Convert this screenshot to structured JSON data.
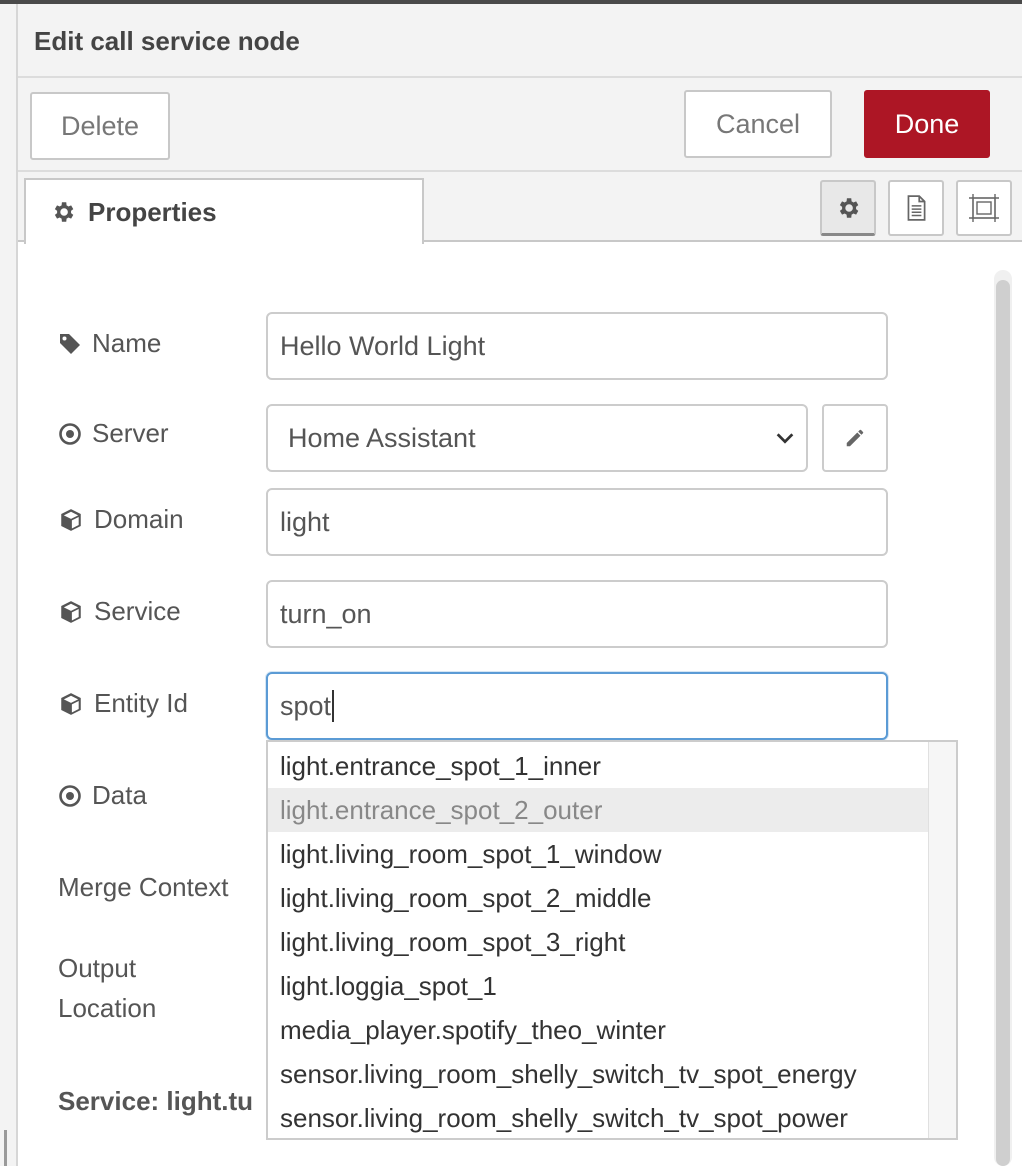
{
  "dialog": {
    "title": "Edit call service node"
  },
  "toolbar": {
    "delete_label": "Delete",
    "cancel_label": "Cancel",
    "done_label": "Done",
    "done_color": "#ad1625"
  },
  "tabs": {
    "properties_label": "Properties",
    "icons": [
      "gear-icon",
      "description-icon",
      "appearance-icon"
    ]
  },
  "form": {
    "name": {
      "label": "Name",
      "value": "Hello World Light",
      "icon": "tag-icon"
    },
    "server": {
      "label": "Server",
      "value": "Home Assistant",
      "icon": "dot-circle-icon"
    },
    "domain": {
      "label": "Domain",
      "value": "light",
      "icon": "cube-icon"
    },
    "service": {
      "label": "Service",
      "value": "turn_on",
      "icon": "cube-icon"
    },
    "entity_id": {
      "label": "Entity Id",
      "value": "spot",
      "icon": "cube-icon"
    },
    "data": {
      "label": "Data",
      "icon": "dot-circle-icon"
    },
    "merge_context": {
      "label": "Merge Context"
    },
    "output_location": {
      "label_line1": "Output",
      "label_line2": "Location"
    },
    "service_info": "Service: light.tu"
  },
  "autocomplete": {
    "items": [
      "light.entrance_spot_1_inner",
      "light.entrance_spot_2_outer",
      "light.living_room_spot_1_window",
      "light.living_room_spot_2_middle",
      "light.living_room_spot_3_right",
      "light.loggia_spot_1",
      "media_player.spotify_theo_winter",
      "sensor.living_room_shelly_switch_tv_spot_energy",
      "sensor.living_room_shelly_switch_tv_spot_power"
    ],
    "highlighted_index": 1
  }
}
